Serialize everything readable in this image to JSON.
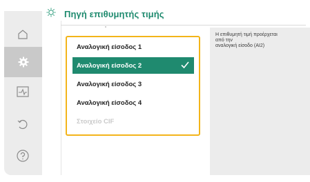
{
  "header": {
    "title": "Πηγή επιθυμητής τιμής",
    "icon": "gear-icon"
  },
  "sidebar": {
    "items": [
      {
        "name": "home",
        "icon": "home-icon"
      },
      {
        "name": "settings",
        "icon": "gear-icon",
        "active": true
      },
      {
        "name": "diagnostics",
        "icon": "pulse-monitor-icon"
      },
      {
        "name": "restore",
        "icon": "undo-icon"
      },
      {
        "name": "help",
        "icon": "question-icon"
      }
    ]
  },
  "options": [
    {
      "label": "Αναλογική είσοδος 1",
      "selected": false,
      "disabled": false
    },
    {
      "label": "Αναλογική είσοδος 2",
      "selected": true,
      "disabled": false
    },
    {
      "label": "Αναλογική είσοδος 3",
      "selected": false,
      "disabled": false
    },
    {
      "label": "Αναλογική είσοδος 4",
      "selected": false,
      "disabled": false
    },
    {
      "label": "Στοιχείο CIF",
      "selected": false,
      "disabled": true
    }
  ],
  "info": {
    "text": "Η επιθυμητή τιμή προέρχεται\nαπό την\nαναλογική είσοδο (AI2)"
  },
  "colors": {
    "accent": "#1f8a6f",
    "focus_frame": "#f3b419",
    "panel": "#ececec"
  }
}
